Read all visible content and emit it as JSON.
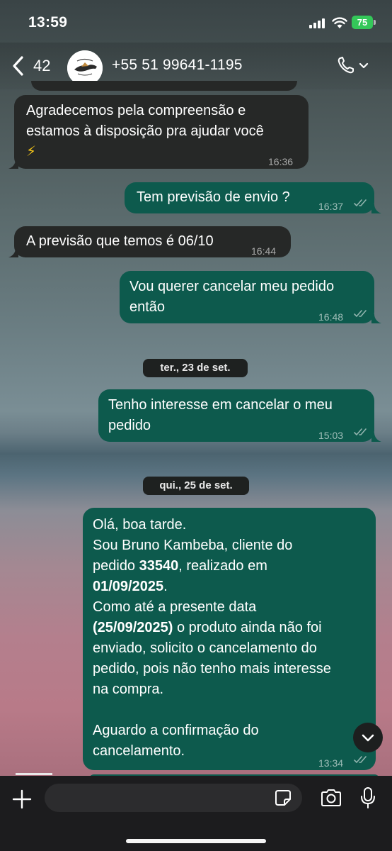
{
  "status_bar": {
    "time": "13:59",
    "battery": "75"
  },
  "header": {
    "back_count": "42",
    "contact": "+55 51 99641-1195"
  },
  "messages": [
    {
      "dir": "in",
      "lines": [
        "Agradecemos pela compreensão e",
        "estamos à disposição pra ajudar você",
        "⚡"
      ],
      "time": "16:36"
    },
    {
      "dir": "out",
      "lines": [
        "Tem previsão de envio ?"
      ],
      "time": "16:37"
    },
    {
      "dir": "in",
      "lines": [
        "A previsão que temos é 06/10"
      ],
      "time": "16:44"
    },
    {
      "dir": "out",
      "lines": [
        "Vou querer cancelar meu pedido",
        "então"
      ],
      "time": "16:48"
    },
    {
      "dir": "out",
      "lines": [
        "Tenho interesse em cancelar o meu",
        "pedido"
      ],
      "time": "15:03"
    },
    {
      "dir": "out",
      "lines": [
        "Olá, boa tarde.",
        "Sou Bruno Kambeba, cliente do",
        "pedido 33540, realizado em",
        "01/09/2025.",
        "Como até a presente data",
        "(25/09/2025) o produto ainda não foi",
        "enviado, solicito o cancelamento do",
        "pedido, pois não tenho mais interesse",
        "na compra.",
        "",
        "Aguardo a confirmação do",
        "cancelamento."
      ],
      "time": "13:34"
    }
  ],
  "date_chips": [
    "ter., 23 de set.",
    "qui., 25 de set."
  ],
  "rich": {
    "l3a": "pedido ",
    "l3b": "33540",
    "l3c": ", realizado em",
    "l4": "01/09/2025",
    "l4b": ".",
    "l6a": "(25/09/2025)",
    "l6b": " o produto ainda não foi"
  },
  "composer": {
    "placeholder": ""
  },
  "icons": {
    "back": "chevron-left-icon",
    "call": "phone-icon",
    "plus": "plus-icon",
    "sticker": "sticker-icon",
    "camera": "camera-icon",
    "mic": "microphone-icon",
    "scroll": "chevron-down-icon",
    "ticks": "double-check-icon"
  },
  "colors": {
    "incoming": "#262827",
    "outgoing": "#0d5a4d",
    "battery": "#34c759"
  }
}
